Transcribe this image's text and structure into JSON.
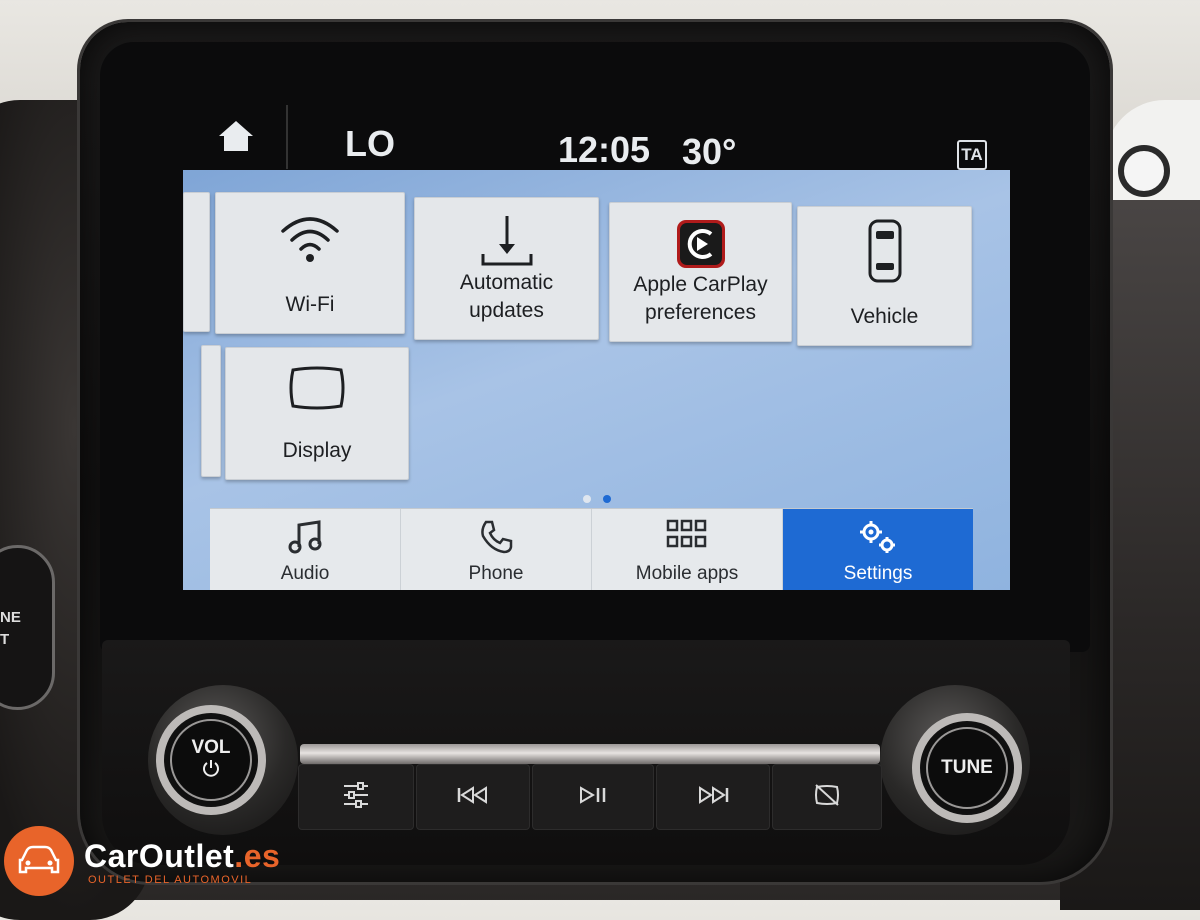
{
  "status_bar": {
    "source": "LO",
    "time": "12:05",
    "temperature": "30°",
    "ta_badge": "TA"
  },
  "settings_grid": {
    "row1": [
      {
        "label": "Wi-Fi",
        "icon": "wifi-icon"
      },
      {
        "label": "Automatic updates",
        "icon": "download-icon"
      },
      {
        "label": "Apple CarPlay preferences",
        "icon": "carplay-icon"
      },
      {
        "label": "Vehicle",
        "icon": "car-top-view-icon"
      }
    ],
    "row2": [
      {
        "label": "Display",
        "icon": "display-icon"
      }
    ]
  },
  "pager": {
    "pages": 2,
    "current": 2
  },
  "nav_bar": {
    "items": [
      {
        "label": "Audio",
        "icon": "music-note-icon"
      },
      {
        "label": "Phone",
        "icon": "phone-icon"
      },
      {
        "label": "Mobile apps",
        "icon": "app-grid-icon"
      },
      {
        "label": "Settings",
        "icon": "gears-icon",
        "active": true
      }
    ]
  },
  "hardware": {
    "vol_label": "VOL",
    "tune_label": "TUNE",
    "buttons": [
      "equalizer-icon",
      "previous-track-icon",
      "play-pause-icon",
      "next-track-icon",
      "screen-off-icon"
    ]
  },
  "watermark": {
    "brand": "CarOutlet",
    "tld": ".es",
    "tagline": "OUTLET DEL AUTOMOVIL"
  },
  "colors": {
    "active_tab": "#1e6ad3",
    "screen_bg": "#a8c3e6",
    "tile_bg": "#e4e7ea",
    "brand_orange": "#e8642a"
  }
}
